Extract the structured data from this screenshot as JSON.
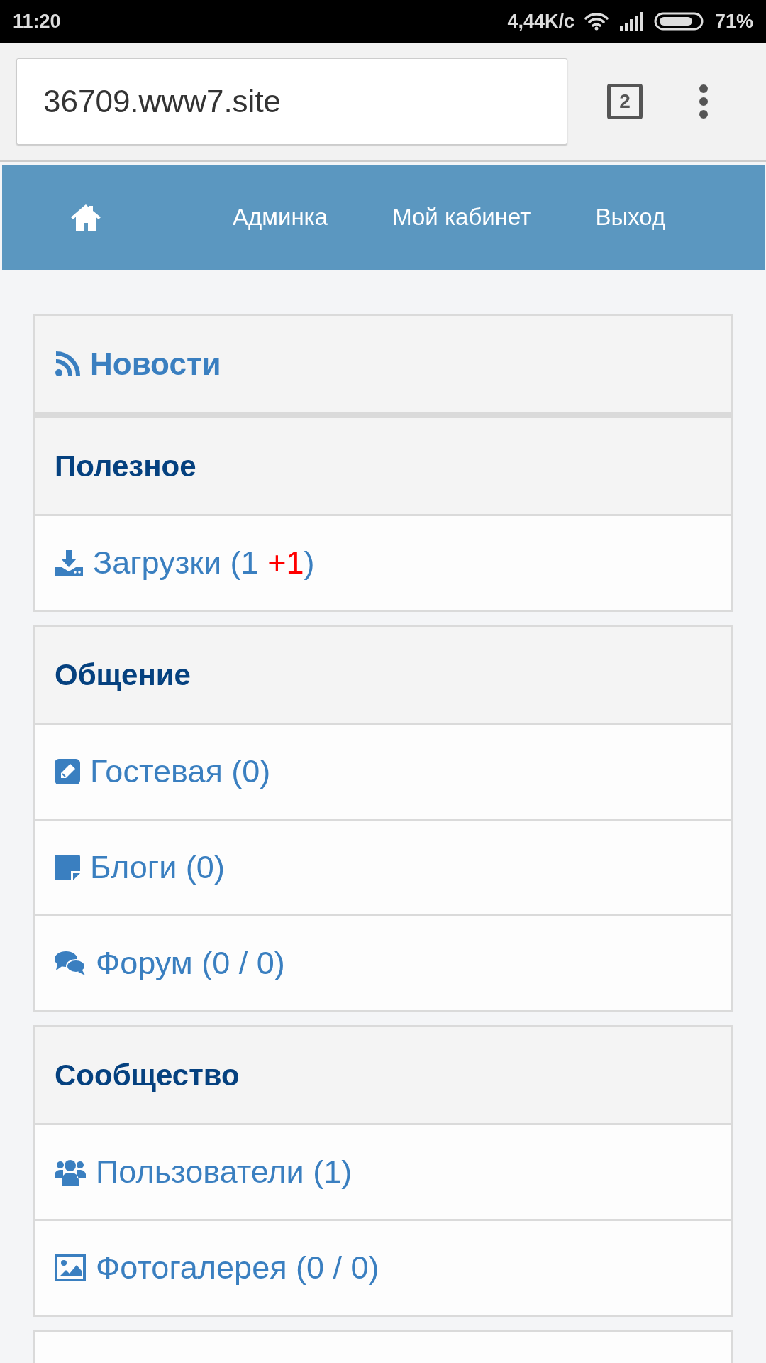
{
  "status_bar": {
    "time": "11:20",
    "network_speed": "4,44K/c",
    "battery": "71%"
  },
  "browser": {
    "url": "36709.www7.site",
    "tab_count": "2"
  },
  "nav": {
    "items": [
      {
        "label": "Админка"
      },
      {
        "label": "Мой кабинет"
      },
      {
        "label": "Выход"
      }
    ]
  },
  "news": {
    "label": "Новости"
  },
  "sections": [
    {
      "title": "Полезное",
      "items": [
        {
          "kind": "download",
          "parts": [
            {
              "text": "Загрузки (1 ",
              "highlight": false
            },
            {
              "text": "+1",
              "highlight": true
            },
            {
              "text": ")",
              "highlight": false
            }
          ]
        }
      ]
    },
    {
      "title": "Общение",
      "items": [
        {
          "kind": "pencil",
          "parts": [
            {
              "text": "Гостевая (0)",
              "highlight": false
            }
          ]
        },
        {
          "kind": "note",
          "parts": [
            {
              "text": "Блоги (0)",
              "highlight": false
            }
          ]
        },
        {
          "kind": "comments",
          "parts": [
            {
              "text": "Форум (0 / 0)",
              "highlight": false
            }
          ]
        }
      ]
    },
    {
      "title": "Сообщество",
      "items": [
        {
          "kind": "users",
          "parts": [
            {
              "text": "Пользователи (1)",
              "highlight": false
            }
          ]
        },
        {
          "kind": "image",
          "parts": [
            {
              "text": "Фотогалерея (0 / 0)",
              "highlight": false
            }
          ]
        }
      ]
    }
  ]
}
